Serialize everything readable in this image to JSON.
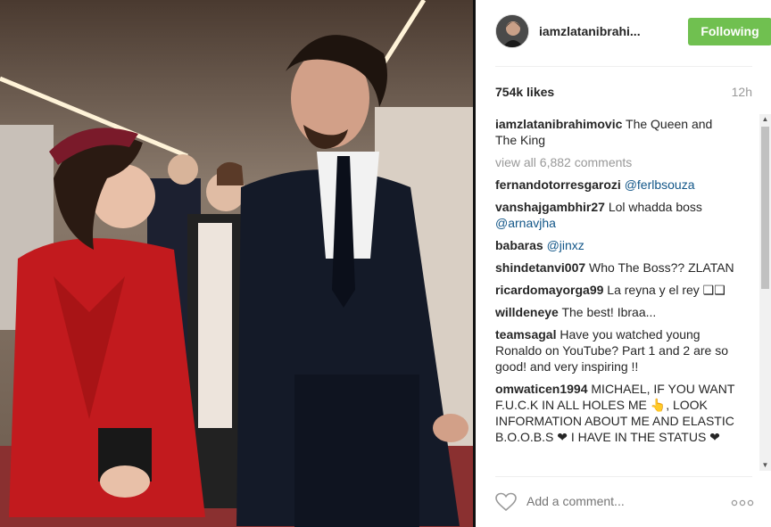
{
  "post": {
    "username": "iamzlatanibrahi...",
    "follow_label": "Following",
    "likes": "754k likes",
    "time": "12h",
    "caption": {
      "user": "iamzlatanibrahimovic",
      "text": " The Queen and The King"
    },
    "view_all": "view all 6,882 comments",
    "comments": [
      {
        "user": "fernandotorresgarozi",
        "text": "",
        "mention": " @ferlbsouza"
      },
      {
        "user": "vanshajgambhir27",
        "text": " Lol whadda boss ",
        "mention": "@arnavjha"
      },
      {
        "user": "babaras",
        "text": "",
        "mention": " @jinxz"
      },
      {
        "user": "shindetanvi007",
        "text": " Who The Boss?? ZLATAN",
        "mention": ""
      },
      {
        "user": "ricardomayorga99",
        "text": " La reyna y el rey ❑❑",
        "mention": ""
      },
      {
        "user": "willdeneye",
        "text": " The best! Ibraa...",
        "mention": ""
      },
      {
        "user": "teamsagal",
        "text": " Have you watched young Ronaldo on YouTube? Part 1 and 2 are so good! and very inspiring !!",
        "mention": ""
      },
      {
        "user": "omwaticen1994",
        "text": " MICHAEL, IF YOU WANT F.U.C.K IN ALL HOLES ME 👆, LOOK INFORMATION ABOUT ME AND ELASTIC B.O.O.B.S ❤ I HAVE IN THE STATUS ❤",
        "mention": ""
      }
    ],
    "add_comment_placeholder": "Add a comment..."
  },
  "colors": {
    "follow_green": "#70c050",
    "mention_blue": "#125688"
  }
}
